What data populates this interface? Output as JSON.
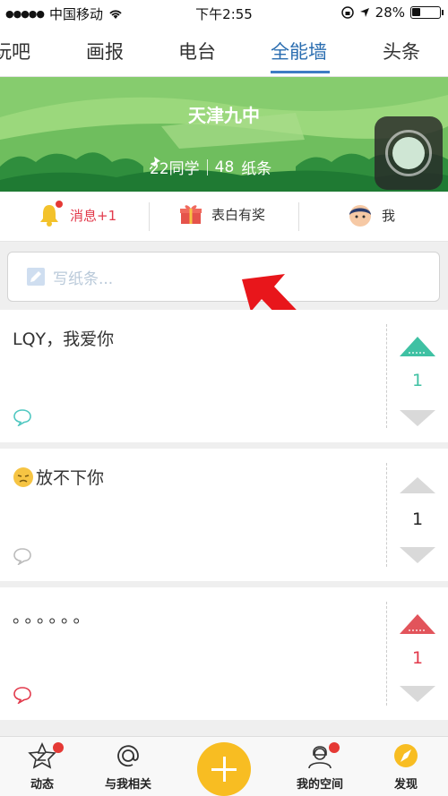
{
  "status_bar": {
    "carrier": "中国移动",
    "time": "下午2:55",
    "battery": "28%"
  },
  "tabs": [
    {
      "label": "玩吧",
      "active": false
    },
    {
      "label": "画报",
      "active": false
    },
    {
      "label": "电台",
      "active": false
    },
    {
      "label": "全能墙",
      "active": true
    },
    {
      "label": "头条",
      "active": false
    }
  ],
  "banner": {
    "school": "天津九中",
    "classmates": "22同学",
    "notes_count": "48",
    "notes_label": "纸条"
  },
  "actions": {
    "messages": "消息+1",
    "confession": "表白有奖",
    "me": "我"
  },
  "compose": {
    "placeholder": "写纸条..."
  },
  "posts": [
    {
      "text": "LQY，我爱你",
      "votes": "1",
      "vote_state": "up"
    },
    {
      "text": "放不下你",
      "votes": "1",
      "vote_state": "none",
      "emoji": "sad-face"
    },
    {
      "text": "。。。。。。",
      "votes": "1",
      "vote_state": "down"
    }
  ],
  "bottom_nav": {
    "feed": "动态",
    "mentions": "与我相关",
    "my_space": "我的空间",
    "discover": "发现"
  },
  "colors": {
    "accent": "#3e7cc4",
    "green": "#40c1a3",
    "red": "#e2394b",
    "fab": "#f8bd22"
  }
}
